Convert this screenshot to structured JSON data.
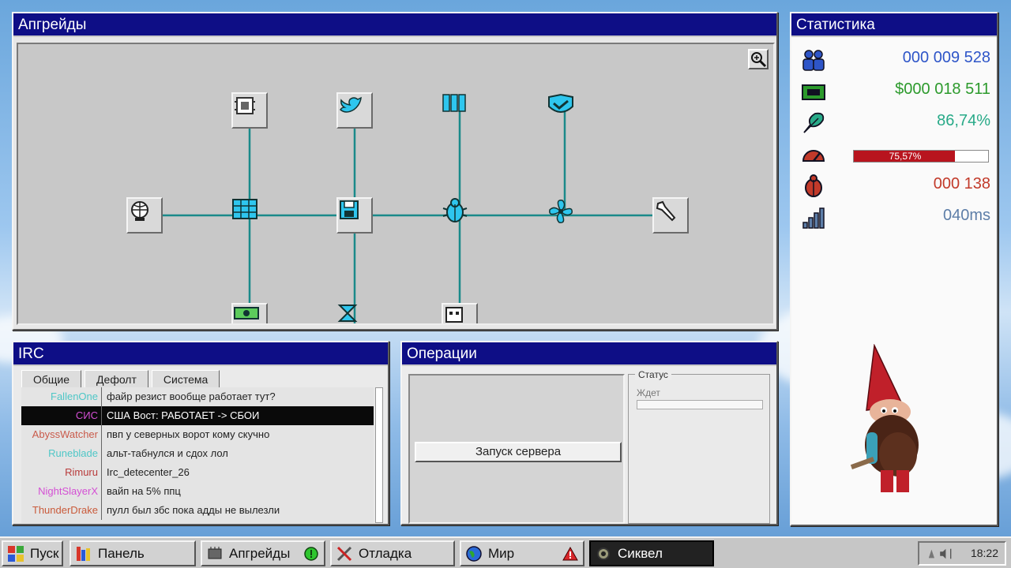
{
  "upgrades": {
    "title": "Апгрейды"
  },
  "stats": {
    "title": "Статистика",
    "users": "000 009 528",
    "money": "$000 018 511",
    "rate": "86,74%",
    "load_label": "75,57%",
    "load_value": 0.7557,
    "bugs": "000 138",
    "ping": "040ms",
    "colors": {
      "users": "#2e55c8",
      "money": "#2c9a2c",
      "rate": "#28aa88",
      "bugs": "#c23a2a",
      "ping": "#5d7ea8"
    }
  },
  "irc": {
    "title": "IRC",
    "tabs": [
      "Общие",
      "Дефолт",
      "Система"
    ],
    "messages": [
      {
        "nick": "FallenOne",
        "text": "файр резист вообще работает тут?",
        "color": "#4fc7c7"
      },
      {
        "nick": "СИС",
        "text": "США Вост: РАБОТАЕТ -> СБОИ",
        "color": "#d44fd4"
      },
      {
        "nick": "AbyssWatcher",
        "text": "пвп у северных ворот кому скучно",
        "color": "#c95a4a"
      },
      {
        "nick": "Runeblade",
        "text": "альт-табнулся и сдох лол",
        "color": "#4fc7c7"
      },
      {
        "nick": "Rimuru",
        "text": "Irc_detecenter_26",
        "color": "#b83a3a"
      },
      {
        "nick": "NightSlayerX",
        "text": "вайп на 5% ппц",
        "color": "#d44fd4"
      },
      {
        "nick": "ThunderDrake",
        "text": "пулл был збс пока адды не вылезли",
        "color": "#c95a3a"
      }
    ]
  },
  "operations": {
    "title": "Операции",
    "run_button": "Запуск сервера",
    "status_label": "Статус",
    "status_value": "Ждет"
  },
  "taskbar": {
    "start": "Пуск",
    "panel": "Панель",
    "upgrades": "Апгрейды",
    "debug": "Отладка",
    "world": "Мир",
    "sequel": "Сиквел",
    "clock": "18:22"
  }
}
